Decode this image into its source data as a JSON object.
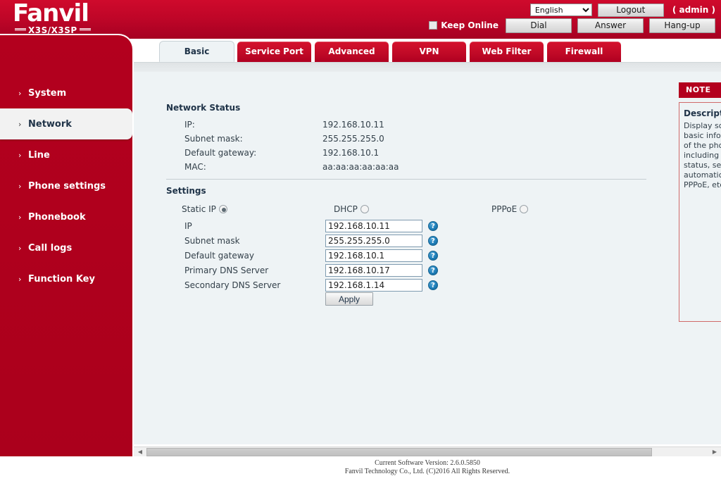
{
  "header": {
    "logo_name": "Fanvil",
    "logo_model": "X3S/X3SP",
    "language_selected": "English",
    "language_options": [
      "English"
    ],
    "logout_label": "Logout",
    "user_label": "( admin )",
    "keep_online_label": "Keep Online",
    "keep_online_checked": false,
    "dial_label": "Dial",
    "answer_label": "Answer",
    "hangup_label": "Hang-up"
  },
  "sidebar": {
    "items": [
      {
        "label": "System",
        "active": false
      },
      {
        "label": "Network",
        "active": true
      },
      {
        "label": "Line",
        "active": false
      },
      {
        "label": "Phone settings",
        "active": false
      },
      {
        "label": "Phonebook",
        "active": false
      },
      {
        "label": "Call logs",
        "active": false
      },
      {
        "label": "Function Key",
        "active": false
      }
    ]
  },
  "tabs": [
    {
      "label": "Basic",
      "active": true
    },
    {
      "label": "Service Port",
      "active": false
    },
    {
      "label": "Advanced",
      "active": false
    },
    {
      "label": "VPN",
      "active": false
    },
    {
      "label": "Web Filter",
      "active": false
    },
    {
      "label": "Firewall",
      "active": false
    }
  ],
  "network_status": {
    "title": "Network Status",
    "rows": [
      {
        "label": "IP:",
        "value": "192.168.10.11"
      },
      {
        "label": "Subnet mask:",
        "value": "255.255.255.0"
      },
      {
        "label": "Default gateway:",
        "value": "192.168.10.1"
      },
      {
        "label": "MAC:",
        "value": "aa:aa:aa:aa:aa:aa"
      }
    ]
  },
  "settings": {
    "title": "Settings",
    "modes": [
      {
        "label": "Static IP",
        "selected": true
      },
      {
        "label": "DHCP",
        "selected": false
      },
      {
        "label": "PPPoE",
        "selected": false
      }
    ],
    "fields": [
      {
        "label": "IP",
        "value": "192.168.10.11",
        "help": "?"
      },
      {
        "label": "Subnet mask",
        "value": "255.255.255.0",
        "help": "?"
      },
      {
        "label": "Default gateway",
        "value": "192.168.10.1",
        "help": "?"
      },
      {
        "label": "Primary DNS Server",
        "value": "192.168.10.17",
        "help": "?"
      },
      {
        "label": "Secondary DNS Server",
        "value": "192.168.1.14",
        "help": "?"
      }
    ],
    "apply_label": "Apply"
  },
  "note": {
    "header": "NOTE",
    "title": "Description:",
    "text": "Display some basic information of the phone, including network status, setting automatically or PPPoE, etc."
  },
  "footer": {
    "version_line": "Current Software Version: 2.6.0.5850",
    "copyright_line": "Fanvil Technology Co., Ltd. (C)2016 All Rights Reserved."
  },
  "icons": {
    "chevron_right": "›",
    "scroll_left": "◀",
    "scroll_right": "▶",
    "dropdown_arrow": "▼"
  }
}
